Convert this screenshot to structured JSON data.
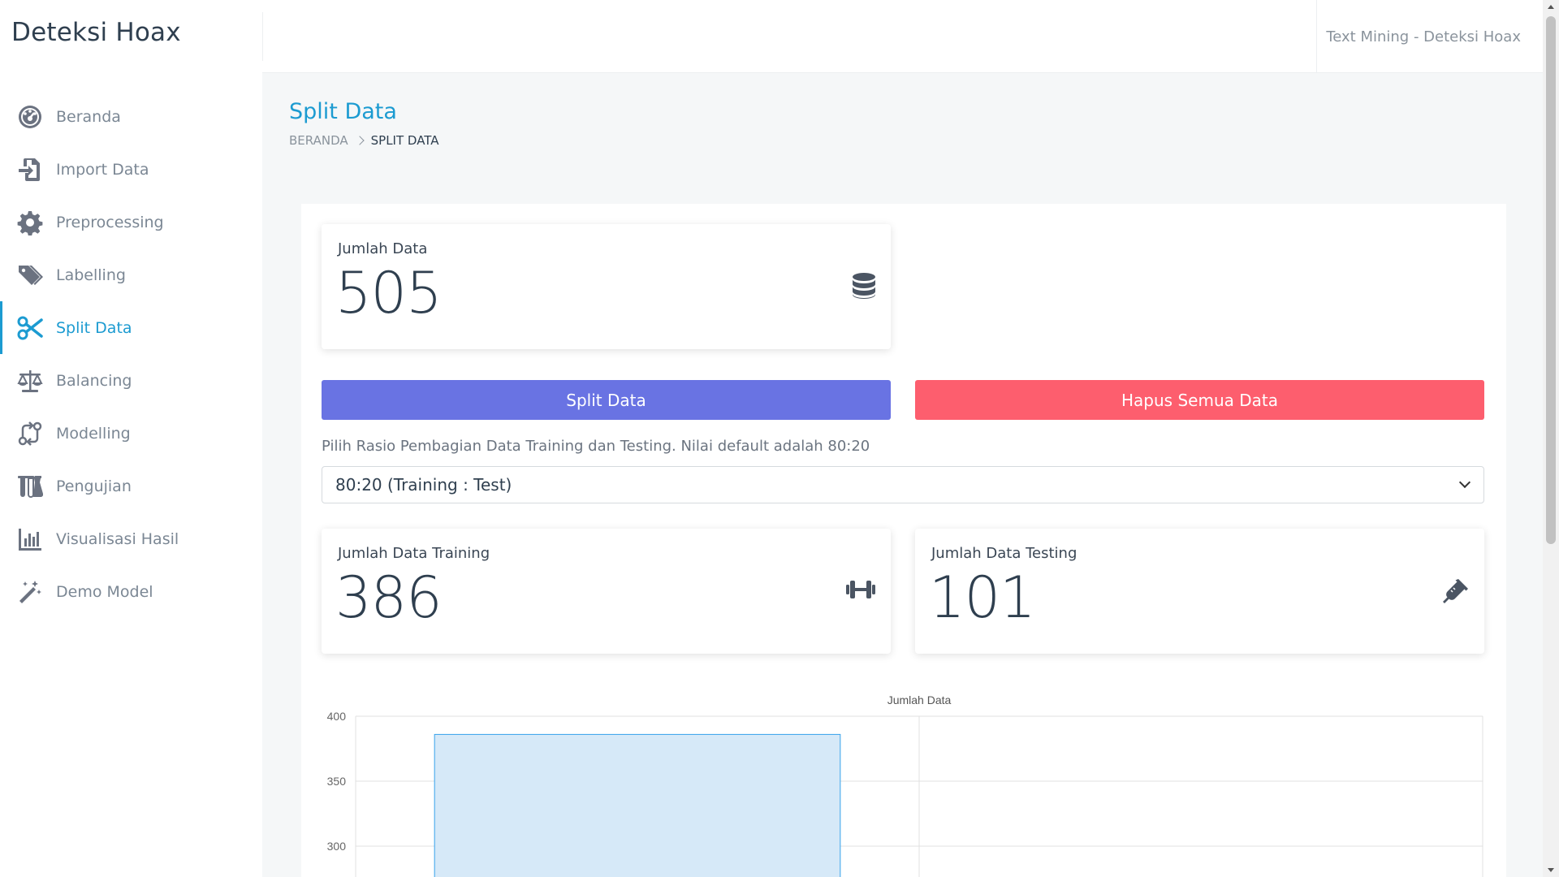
{
  "app": {
    "brand": "Deteksi Hoax",
    "header_text": "Text Mining - Deteksi Hoax"
  },
  "sidebar": {
    "items": [
      {
        "label": "Beranda",
        "icon": "gauge-icon"
      },
      {
        "label": "Import Data",
        "icon": "import-icon"
      },
      {
        "label": "Preprocessing",
        "icon": "gear-icon"
      },
      {
        "label": "Labelling",
        "icon": "tags-icon"
      },
      {
        "label": "Split Data",
        "icon": "scissors-icon",
        "active": true
      },
      {
        "label": "Balancing",
        "icon": "scale-icon"
      },
      {
        "label": "Modelling",
        "icon": "exchange-icon"
      },
      {
        "label": "Pengujian",
        "icon": "flask-icon"
      },
      {
        "label": "Visualisasi Hasil",
        "icon": "chart-icon"
      },
      {
        "label": "Demo Model",
        "icon": "magic-wand-icon"
      }
    ]
  },
  "page": {
    "title": "Split Data",
    "breadcrumb": {
      "home": "BERANDA",
      "current": "SPLIT DATA"
    }
  },
  "stats": {
    "total": {
      "label": "Jumlah Data",
      "value": "505",
      "icon": "database-icon"
    },
    "training": {
      "label": "Jumlah Data Training",
      "value": "386",
      "icon": "dumbbell-icon"
    },
    "testing": {
      "label": "Jumlah Data Testing",
      "value": "101",
      "icon": "syringe-icon"
    }
  },
  "actions": {
    "split_label": "Split Data",
    "delete_label": "Hapus Semua Data"
  },
  "ratio": {
    "label": "Pilih Rasio Pembagian Data Training dan Testing. Nilai default adalah 80:20",
    "selected": "80:20 (Training : Test)"
  },
  "colors": {
    "accent": "#1c9bd1",
    "split_button": "#6973e3",
    "delete_button": "#fd5e6e",
    "bar_fill": "#d6e9f8",
    "bar_border": "#36a2eb"
  },
  "chart_data": {
    "type": "bar",
    "title": "Jumlah Data",
    "categories": [
      "",
      ""
    ],
    "values": [
      386,
      null
    ],
    "yticks": [
      400,
      350,
      300
    ],
    "ylim": [
      280,
      400
    ],
    "grid": true
  }
}
